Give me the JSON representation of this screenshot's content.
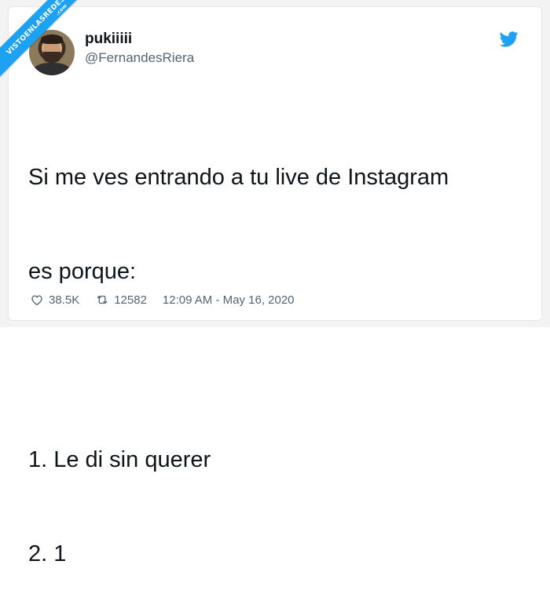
{
  "watermark": {
    "line1": "VISTOENLASREDES",
    "line2": ".com"
  },
  "user": {
    "name": "pukiiiii",
    "handle": "@FernandesRiera"
  },
  "tweet": {
    "lines": [
      "Si me ves entrando a tu live de Instagram",
      "es porque:",
      "",
      "1. Le di sin querer",
      "2. 1"
    ]
  },
  "stats": {
    "likes": "38.5K",
    "retweets": "12582",
    "timestamp": "12:09 AM - May 16, 2020"
  },
  "icons": {
    "brand": "twitter-bird-icon",
    "like": "heart-icon",
    "retweet": "retweet-icon"
  },
  "colors": {
    "brand": "#1da1f2",
    "text": "#0f1419",
    "muted": "#536471"
  }
}
